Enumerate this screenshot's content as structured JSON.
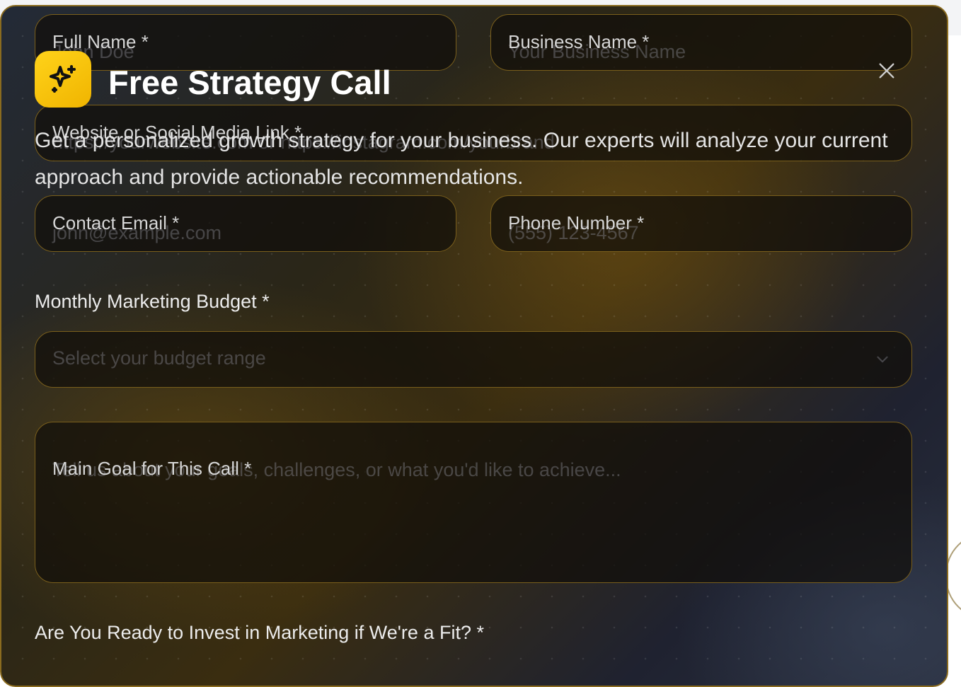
{
  "header": {
    "title": "Free Strategy Call",
    "description": "Get a personalized growth strategy for your business. Our experts will analyze your current approach and provide actionable recommendations."
  },
  "form": {
    "full_name": {
      "label": "Full Name *",
      "placeholder": "John Doe"
    },
    "business_name": {
      "label": "Business Name *",
      "placeholder": "Your Business Name"
    },
    "website": {
      "label": "Website or Social Media Link *",
      "placeholder": "https://yourwebsite.com or https://instagram.com/yourbrand"
    },
    "email": {
      "label": "Contact Email *",
      "placeholder": "john@example.com"
    },
    "phone": {
      "label": "Phone Number *",
      "placeholder": "(555) 123-4567"
    },
    "budget": {
      "label": "Monthly Marketing Budget *",
      "placeholder": "Select your budget range"
    },
    "goal": {
      "label": "Main Goal for This Call *",
      "placeholder": "Tell us about your goals, challenges, or what you'd like to achieve..."
    },
    "ready_to_invest": {
      "label": "Are You Ready to Invest in Marketing if We're a Fit? *"
    }
  },
  "icons": {
    "header": "sparkles-icon",
    "close": "close-icon",
    "budget_dropdown": "chevron-down-icon"
  },
  "colors": {
    "accent": "#f5c518",
    "border": "#7a5f1c",
    "text": "#e4e4e4"
  }
}
